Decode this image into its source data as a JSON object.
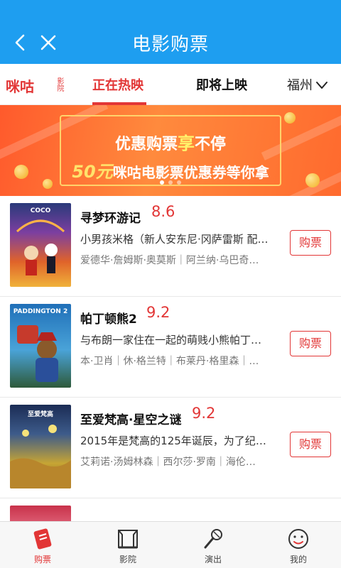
{
  "header": {
    "title": "电影购票"
  },
  "tabs": {
    "logo": "咪咕",
    "logo_sub": "影院",
    "now_showing": "正在热映",
    "coming_soon": "即将上映",
    "city": "福州"
  },
  "banner": {
    "line1_a": "优惠购票",
    "line1_b": "享",
    "line1_c": "不停",
    "line2_amount": "50元",
    "line2_text": "咪咕电影票优惠券等你拿"
  },
  "movies": [
    {
      "name": "寻梦环游记",
      "score": "8.6",
      "desc": "小男孩米格（新人安东尼·冈萨雷斯 配…",
      "cast": "爱德华·詹姆斯·奥莫斯｜阿兰纳·乌巴奇…",
      "buy": "购票",
      "poster_title": "COCO"
    },
    {
      "name": "帕丁顿熊2",
      "score": "9.2",
      "desc": "与布朗一家住在一起的萌贱小熊帕丁…",
      "cast": "本·卫肖｜休·格兰特｜布莱丹·格里森｜…",
      "buy": "购票",
      "poster_title": "PADDINGTON 2"
    },
    {
      "name": "至爱梵高·星空之谜",
      "score": "9.2",
      "desc": "2015年是梵高的125年诞辰，为了纪念…",
      "cast": "艾莉诺·汤姆林森｜西尔莎·罗南｜海伦…",
      "buy": "购票",
      "poster_title": "至爱梵高"
    }
  ],
  "nav": {
    "tickets": "购票",
    "cinema": "影院",
    "shows": "演出",
    "mine": "我的"
  },
  "colors": {
    "header": "#1e9ef0",
    "accent": "#e23636"
  }
}
